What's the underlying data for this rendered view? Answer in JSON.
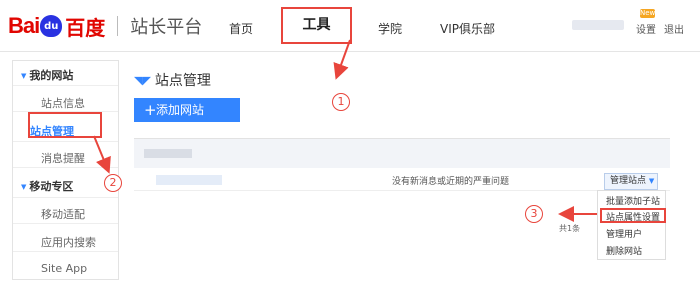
{
  "header": {
    "logo_bai": "Bai",
    "logo_du": "du",
    "logo_cn": "百度",
    "site_name": "站长平台",
    "nav": [
      "首页",
      "工具",
      "学院",
      "VIP俱乐部"
    ],
    "new_badge": "New",
    "settings": "设置",
    "logout": "退出"
  },
  "sidebar": {
    "group1": "我的网站",
    "items1": [
      "站点信息",
      "站点管理",
      "消息提醒"
    ],
    "group2": "移动专区",
    "items2": [
      "移动适配",
      "应用内搜索",
      "Site App"
    ]
  },
  "main": {
    "title": "站点管理",
    "add_button": "添加网站",
    "row_message": "没有新消息或近期的严重问题",
    "manage_button": "管理站点",
    "menu": [
      "批量添加子站",
      "站点属性设置",
      "管理用户",
      "删除网站"
    ],
    "pager": "共1条"
  },
  "annotations": [
    "1",
    "2",
    "3"
  ],
  "colors": {
    "accent": "#3385ff",
    "annotation": "#e8453c",
    "brand": "#e10601"
  }
}
